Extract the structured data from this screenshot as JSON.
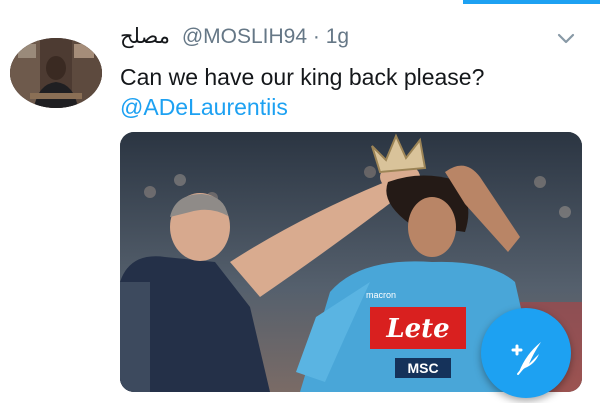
{
  "tweet": {
    "display_name": "مصلح",
    "handle": "@MOSLIH94",
    "separator": "·",
    "time": "1g",
    "text": "Can we have our king back please?",
    "mention": "@ADeLaurentiis"
  },
  "media": {
    "jersey_sponsor": "Lete",
    "jersey_sub_sponsor": "MSC",
    "jersey_brand": "macron"
  },
  "icons": {
    "menu": "chevron-down-icon",
    "compose": "compose-feather-icon"
  },
  "colors": {
    "accent": "#1da1f2",
    "secondary_text": "#657786",
    "primary_text": "#14171a"
  }
}
